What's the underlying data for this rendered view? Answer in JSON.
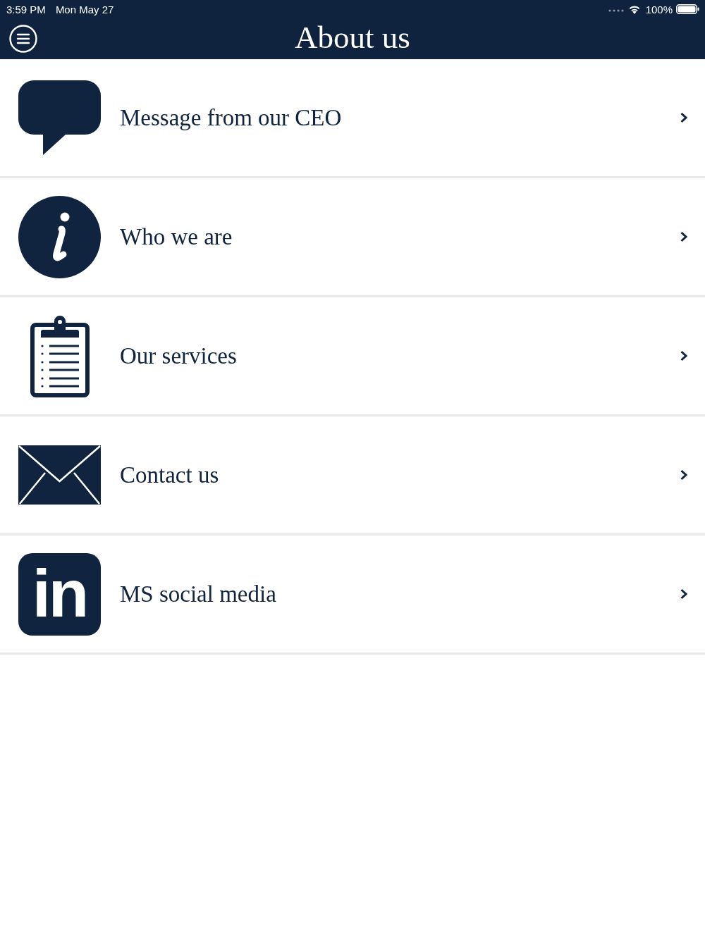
{
  "status_bar": {
    "time": "3:59 PM",
    "date": "Mon May 27",
    "battery": "100%"
  },
  "nav_bar": {
    "title": "About us"
  },
  "items": [
    {
      "label": "Message from our CEO"
    },
    {
      "label": "Who we are"
    },
    {
      "label": "Our services"
    },
    {
      "label": "Contact us"
    },
    {
      "label": "MS social media",
      "logo_text": "in"
    }
  ]
}
